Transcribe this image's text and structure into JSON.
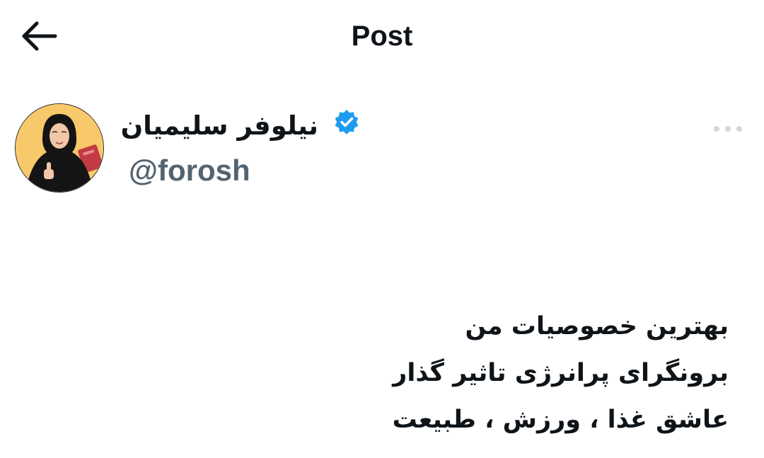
{
  "header": {
    "back_icon": "arrow-left-icon",
    "title": "Post"
  },
  "author": {
    "name": "نیلوفر سلیمیان",
    "handle": "@forosh",
    "verified_icon": "verified-badge-icon",
    "verified_color": "#1d9bf0",
    "avatar_bg_color": "#f8c96a"
  },
  "post": {
    "more_icon": "more-horizontal-icon",
    "lines": [
      "بهترین خصوصیات من",
      "برونگرای پرانرژی تاثیر گذار",
      "عاشق غذا ، ورزش ، طبیعت"
    ]
  },
  "colors": {
    "text": "#0f1419",
    "secondary_text": "#536471",
    "icon_muted": "#cfd9de"
  }
}
